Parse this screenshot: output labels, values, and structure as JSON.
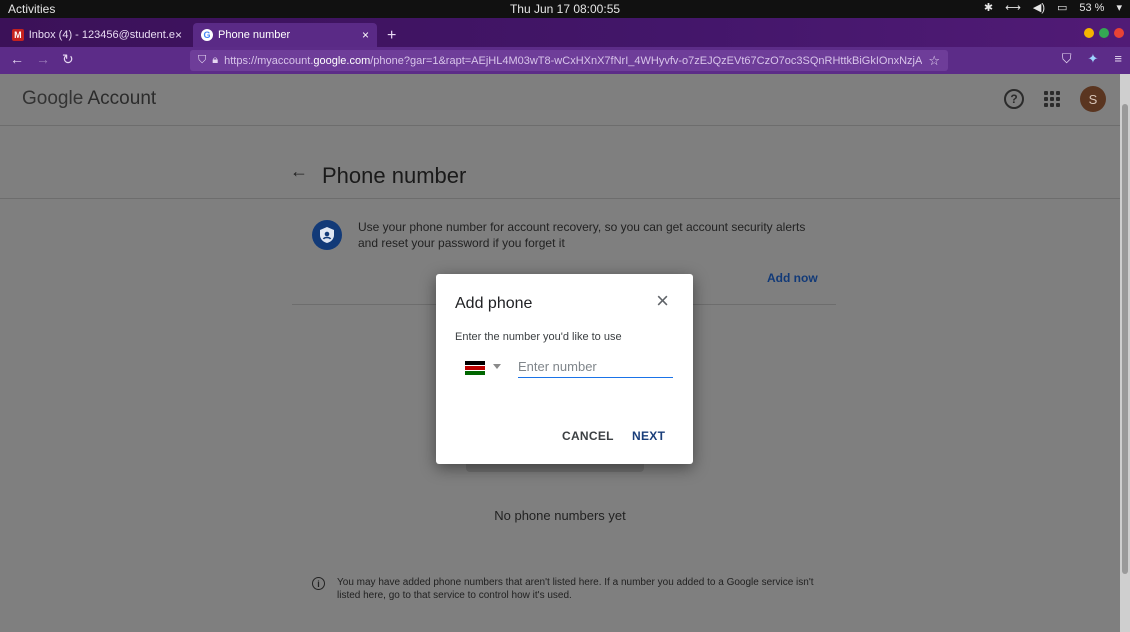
{
  "system": {
    "activities": "Activities",
    "clock": "Thu Jun 17 08:00:55",
    "battery": "53 %"
  },
  "browser": {
    "tabs": [
      {
        "label": "Inbox (4) - 123456@student.e",
        "close": "×"
      },
      {
        "label": "Phone number",
        "close": "×"
      }
    ],
    "new_tab": "+",
    "url_prefix": "https://myaccount.",
    "url_domain": "google.com",
    "url_rest": "/phone?gar=1&rapt=AEjHL4M03wT8-wCxHXnX7fNrI_4WHyvfv-o7zEJQzEVt67CzO7oc3SQnRHttkBiGkIOnxNzjA"
  },
  "page": {
    "logo_google": "Google",
    "logo_account": " Account",
    "avatar_letter": "S",
    "title": "Phone number",
    "recovery_text": "Use your phone number for account recovery, so you can get account security alerts and reset your password if you forget it",
    "add_now": "Add now",
    "no_phones": "No phone numbers yet",
    "note": "You may have added phone numbers that aren't listed here. If a number you added to a Google service isn't listed here, go to that service to control how it's used."
  },
  "dialog": {
    "title": "Add phone",
    "close": "×",
    "subtitle": "Enter the number you'd like to use",
    "input_placeholder": "Enter number",
    "input_value": "",
    "cancel": "CANCEL",
    "next": "NEXT"
  },
  "colors": {
    "accent": "#1a73e8",
    "tabbar": "#43166a",
    "navbar": "#5c2c88",
    "overlay_page": "#7f7f7f"
  }
}
